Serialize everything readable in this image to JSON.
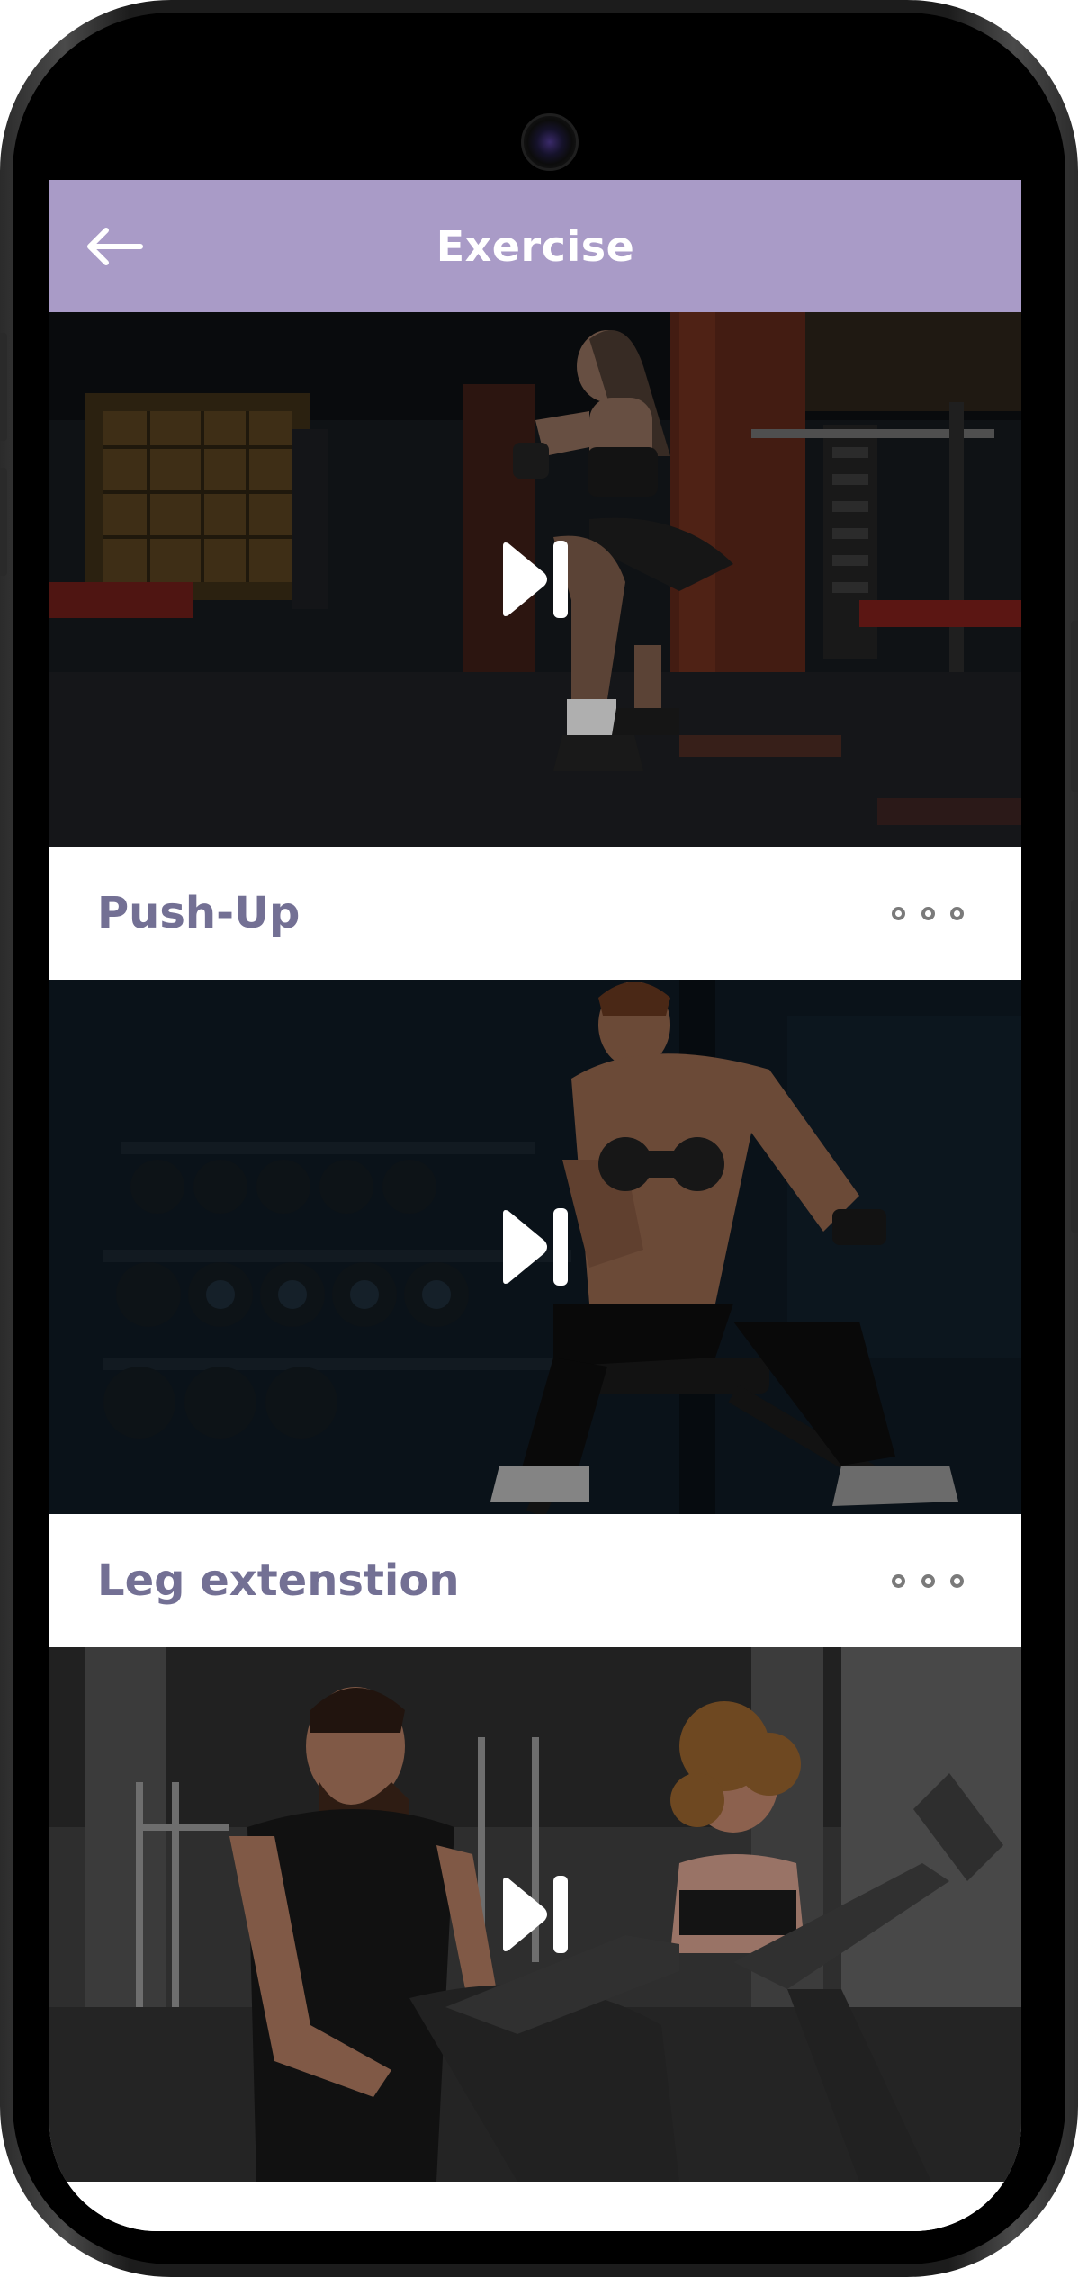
{
  "header": {
    "title": "Exercise",
    "back_icon": "arrow-left-icon",
    "background_color": "#a99bc7"
  },
  "exercises": [
    {
      "title": "Push-Up",
      "image": "woman-squatting-in-gym",
      "play_icon": "play-pause-icon",
      "more_icon": "more-horizontal-icon"
    },
    {
      "title": "Leg extenstion",
      "image": "man-with-dumbbell-on-bench",
      "play_icon": "play-pause-icon",
      "more_icon": "more-horizontal-icon"
    },
    {
      "title": "",
      "image": "couple-on-exercise-bikes",
      "play_icon": "play-pause-icon",
      "more_icon": "more-horizontal-icon"
    }
  ],
  "colors": {
    "title_text": "#737094",
    "accent": "#a99bc7"
  }
}
